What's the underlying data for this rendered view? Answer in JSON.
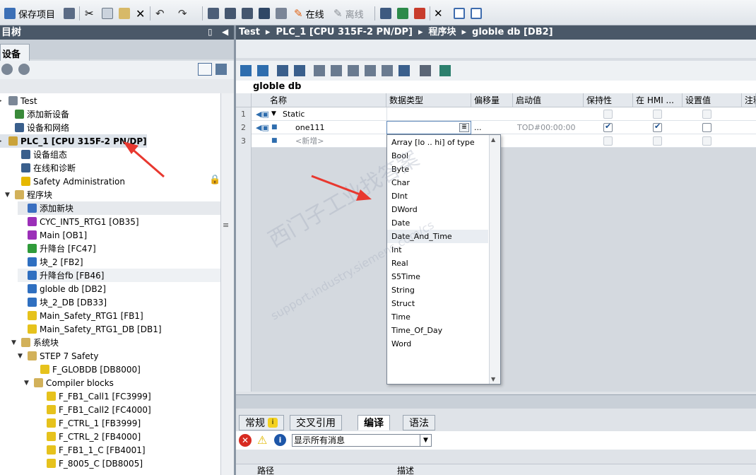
{
  "toolbar": {
    "save_project": "保存项目",
    "online": "在线",
    "offline": "离线"
  },
  "left": {
    "header": "目树",
    "tab": "设备",
    "tree": [
      {
        "label": "Test",
        "indent": 0,
        "icon": "project-icon"
      },
      {
        "label": "添加新设备",
        "indent": 1,
        "icon": "add-device-icon"
      },
      {
        "label": "设备和网络",
        "indent": 1,
        "icon": "network-icon"
      },
      {
        "label": "PLC_1 [CPU 315F-2 PN/DP]",
        "indent": 0,
        "icon": "plc-icon"
      },
      {
        "label": "设备组态",
        "indent": 2,
        "icon": "device-config-icon"
      },
      {
        "label": "在线和诊断",
        "indent": 2,
        "icon": "diagnostics-icon"
      },
      {
        "label": "Safety Administration",
        "indent": 2,
        "icon": "safety-icon"
      },
      {
        "label": "程序块",
        "indent": 1,
        "icon": "folder-icon"
      },
      {
        "label": "添加新块",
        "indent": 3,
        "icon": "add-block-icon"
      },
      {
        "label": "CYC_INT5_RTG1 [OB35]",
        "indent": 3,
        "icon": "ob-icon"
      },
      {
        "label": "Main [OB1]",
        "indent": 3,
        "icon": "ob-icon"
      },
      {
        "label": "升降台 [FC47]",
        "indent": 3,
        "icon": "fc-icon"
      },
      {
        "label": "块_2 [FB2]",
        "indent": 3,
        "icon": "fb-icon"
      },
      {
        "label": "升降台fb [FB46]",
        "indent": 3,
        "icon": "fb-icon"
      },
      {
        "label": "globle db [DB2]",
        "indent": 3,
        "icon": "db-icon"
      },
      {
        "label": "块_2_DB [DB33]",
        "indent": 3,
        "icon": "db-icon"
      },
      {
        "label": "Main_Safety_RTG1 [FB1]",
        "indent": 3,
        "icon": "fb-safety-icon"
      },
      {
        "label": "Main_Safety_RTG1_DB [DB1]",
        "indent": 3,
        "icon": "db-safety-icon"
      },
      {
        "label": "系统块",
        "indent": 2,
        "icon": "folder-icon"
      },
      {
        "label": "STEP 7 Safety",
        "indent": 3,
        "icon": "folder-icon"
      },
      {
        "label": "F_GLOBDB [DB8000]",
        "indent": 5,
        "icon": "db-safety-icon"
      },
      {
        "label": "Compiler blocks",
        "indent": 4,
        "icon": "folder-icon"
      },
      {
        "label": "F_FB1_Call1 [FC3999]",
        "indent": 6,
        "icon": "fc-safety-icon"
      },
      {
        "label": "F_FB1_Call2 [FC4000]",
        "indent": 6,
        "icon": "fc-safety-icon"
      },
      {
        "label": "F_CTRL_1 [FB3999]",
        "indent": 6,
        "icon": "fb-safety-icon"
      },
      {
        "label": "F_CTRL_2 [FB4000]",
        "indent": 6,
        "icon": "fb-safety-icon"
      },
      {
        "label": "F_FB1_1_C [FB4001]",
        "indent": 6,
        "icon": "fb-safety-icon"
      },
      {
        "label": "F_8005_C [DB8005]",
        "indent": 6,
        "icon": "db-safety-icon"
      }
    ]
  },
  "breadcrumb": [
    "Test",
    "PLC_1 [CPU 315F-2 PN/DP]",
    "程序块",
    "globle db [DB2]"
  ],
  "editor": {
    "block_title": "globle db",
    "columns": [
      "名称",
      "数据类型",
      "偏移量",
      "启动值",
      "保持性",
      "在 HMI ...",
      "设置值",
      "注释"
    ],
    "rows": [
      {
        "num": "1",
        "name": "Static",
        "type": "",
        "offset": "",
        "start": ""
      },
      {
        "num": "2",
        "name": "one111",
        "type": "",
        "offset": "...",
        "start": "TOD#00:00:00"
      },
      {
        "num": "3",
        "name": "<新增>",
        "type": "",
        "offset": "",
        "start": ""
      }
    ]
  },
  "dropdown": {
    "items": [
      "Array [lo .. hi] of type",
      "Bool",
      "Byte",
      "Char",
      "DInt",
      "DWord",
      "Date",
      "Date_And_Time",
      "Int",
      "Real",
      "S5Time",
      "String",
      "Struct",
      "Time",
      "Time_Of_Day",
      "Word"
    ]
  },
  "bottom": {
    "tabs": [
      "常规",
      "交叉引用",
      "编译",
      "语法"
    ],
    "filter": "显示所有消息",
    "columns": [
      "路径",
      "描述"
    ]
  },
  "watermark": {
    "line1": "西门子工业找答案",
    "line2": "support.industry.siemens.com/cs"
  },
  "colors": {
    "arrow": "#e8382f",
    "header": "#4a5868",
    "checkbox": "#1a4f8f"
  }
}
